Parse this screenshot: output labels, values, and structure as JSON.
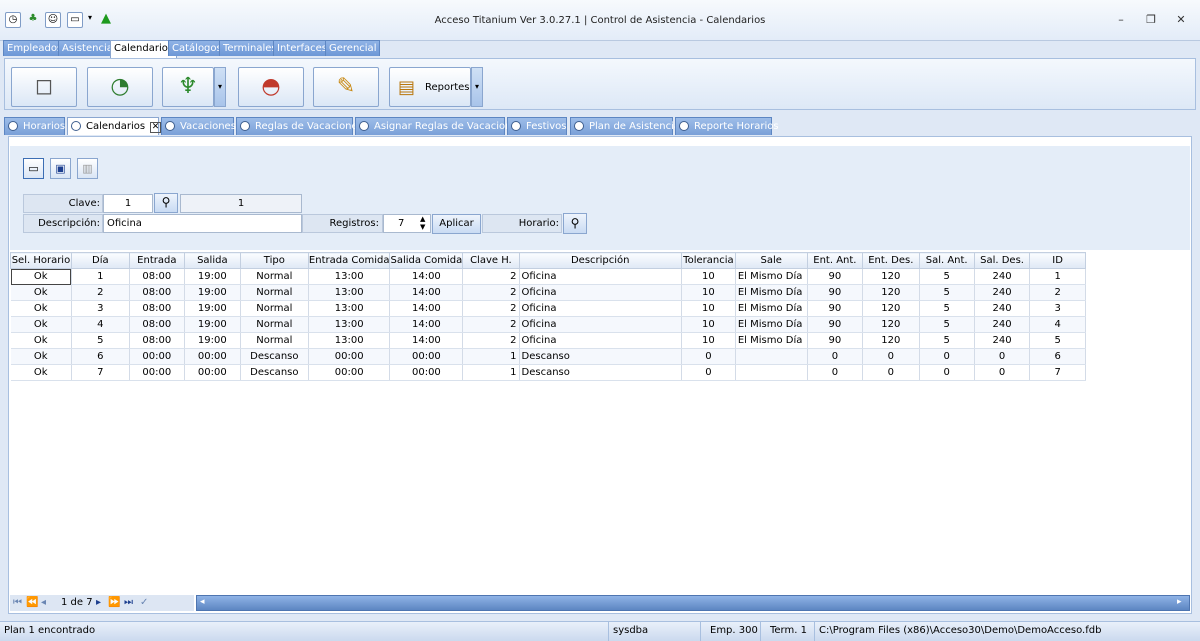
{
  "window": {
    "title": "Acceso Titanium  Ver 3.0.27.1 | Control de Asistencia - Calendarios",
    "min": "–",
    "max": "❐",
    "close": "✕"
  },
  "main_tabs": [
    "Empleados",
    "Asistencia",
    "Calendarios",
    "Catálogos",
    "Terminales",
    "Interfaces",
    "Gerencial"
  ],
  "ribbon": {
    "reportes_label": "Reportes"
  },
  "doc_tabs": [
    "Horarios",
    "Calendarios",
    "Vacaciones",
    "Reglas de Vacaciones",
    "Asignar Reglas de Vacaciones",
    "Festivos",
    "Plan de Asistencia",
    "Reporte Horarios"
  ],
  "form": {
    "clave_label": "Clave:",
    "clave_value": "1",
    "clave_display": "1",
    "descripcion_label": "Descripción:",
    "descripcion_value": "Oficina",
    "registros_label": "Registros:",
    "registros_value": "7",
    "aplicar_label": "Aplicar",
    "horario_label": "Horario:"
  },
  "table": {
    "columns": [
      "Sel. Horario",
      "Día",
      "Entrada",
      "Salida",
      "Tipo",
      "Entrada Comida",
      "Salida Comida",
      "Clave H.",
      "Descripción",
      "Tolerancia",
      "Sale",
      "Ent. Ant.",
      "Ent. Des.",
      "Sal. Ant.",
      "Sal. Des.",
      "ID"
    ],
    "rows": [
      [
        "Ok",
        "1",
        "08:00",
        "19:00",
        "Normal",
        "13:00",
        "14:00",
        "2",
        "Oficina",
        "10",
        "El Mismo Día",
        "90",
        "120",
        "5",
        "240",
        "1"
      ],
      [
        "Ok",
        "2",
        "08:00",
        "19:00",
        "Normal",
        "13:00",
        "14:00",
        "2",
        "Oficina",
        "10",
        "El Mismo Día",
        "90",
        "120",
        "5",
        "240",
        "2"
      ],
      [
        "Ok",
        "3",
        "08:00",
        "19:00",
        "Normal",
        "13:00",
        "14:00",
        "2",
        "Oficina",
        "10",
        "El Mismo Día",
        "90",
        "120",
        "5",
        "240",
        "3"
      ],
      [
        "Ok",
        "4",
        "08:00",
        "19:00",
        "Normal",
        "13:00",
        "14:00",
        "2",
        "Oficina",
        "10",
        "El Mismo Día",
        "90",
        "120",
        "5",
        "240",
        "4"
      ],
      [
        "Ok",
        "5",
        "08:00",
        "19:00",
        "Normal",
        "13:00",
        "14:00",
        "2",
        "Oficina",
        "10",
        "El Mismo Día",
        "90",
        "120",
        "5",
        "240",
        "5"
      ],
      [
        "Ok",
        "6",
        "00:00",
        "00:00",
        "Descanso",
        "00:00",
        "00:00",
        "1",
        "Descanso",
        "0",
        "",
        "0",
        "0",
        "0",
        "0",
        "6"
      ],
      [
        "Ok",
        "7",
        "00:00",
        "00:00",
        "Descanso",
        "00:00",
        "00:00",
        "1",
        "Descanso",
        "0",
        "",
        "0",
        "0",
        "0",
        "0",
        "7"
      ]
    ]
  },
  "pager": {
    "text": "1 de 7"
  },
  "status": {
    "message": "Plan 1 encontrado",
    "user": "sysdba",
    "emp": "Emp. 300",
    "term": "Term. 1",
    "path": "C:\\Program Files (x86)\\Acceso30\\Demo\\DemoAcceso.fdb"
  }
}
